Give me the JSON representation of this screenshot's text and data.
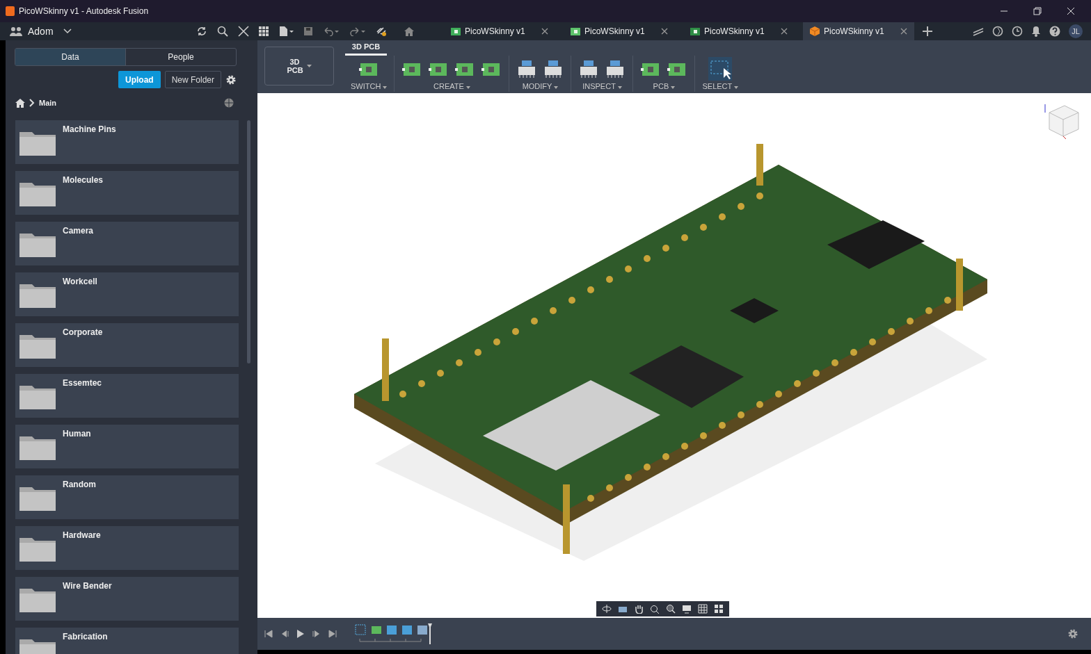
{
  "window": {
    "title": "PicoWSkinny v1 - Autodesk Fusion"
  },
  "app_bar": {
    "team": "Adom",
    "avatar": "JL"
  },
  "document_tabs": [
    {
      "label": "PicoWSkinny v1",
      "kind": "schematic",
      "selected": false
    },
    {
      "label": "PicoWSkinny v1",
      "kind": "layout",
      "selected": false
    },
    {
      "label": "PicoWSkinny v1",
      "kind": "board",
      "selected": false
    },
    {
      "label": "PicoWSkinny v1",
      "kind": "design",
      "selected": true
    }
  ],
  "data_panel": {
    "tabs": [
      {
        "label": "Data",
        "selected": true
      },
      {
        "label": "People",
        "selected": false
      }
    ],
    "upload": "Upload",
    "new_folder": "New Folder",
    "breadcrumb": "Main",
    "folders": [
      "Machine Pins",
      "Molecules",
      "Camera",
      "Workcell",
      "Corporate",
      "Essemtec",
      "Human",
      "Random",
      "Hardware",
      "Wire Bender",
      "Fabrication"
    ]
  },
  "toolbar": {
    "workspace": "3D PCB",
    "ribbon_tab": "3D PCB",
    "groups": [
      {
        "label": "SWITCH",
        "kind": "switch"
      },
      {
        "label": "CREATE",
        "kind": "create"
      },
      {
        "label": "MODIFY",
        "kind": "modify"
      },
      {
        "label": "INSPECT",
        "kind": "inspect"
      },
      {
        "label": "PCB",
        "kind": "pcb"
      },
      {
        "label": "SELECT",
        "kind": "select"
      }
    ]
  }
}
